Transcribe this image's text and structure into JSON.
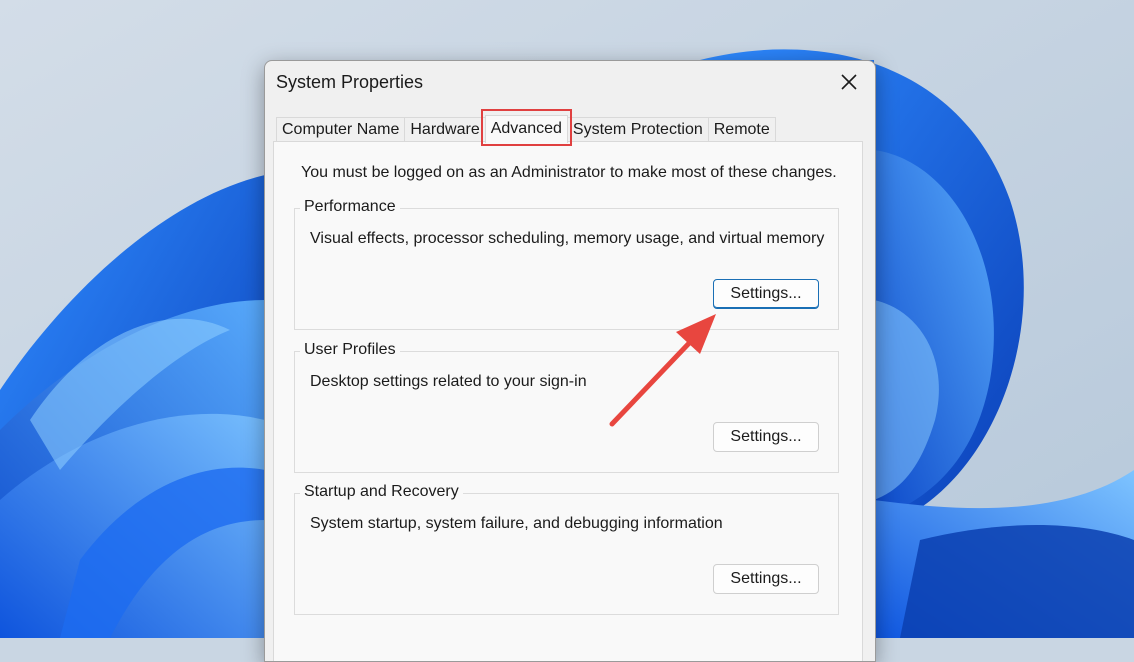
{
  "dialog": {
    "title": "System Properties",
    "close_icon": "close-icon"
  },
  "tabs": [
    {
      "label": "Computer Name",
      "active": false
    },
    {
      "label": "Hardware",
      "active": false
    },
    {
      "label": "Advanced",
      "active": true,
      "highlighted": true
    },
    {
      "label": "System Protection",
      "active": false
    },
    {
      "label": "Remote",
      "active": false
    }
  ],
  "panel": {
    "admin_note": "You must be logged on as an Administrator to make most of these changes.",
    "groups": [
      {
        "label": "Performance",
        "description": "Visual effects, processor scheduling, memory usage, and virtual memory",
        "button_label": "Settings...",
        "focused": true
      },
      {
        "label": "User Profiles",
        "description": "Desktop settings related to your sign-in",
        "button_label": "Settings...",
        "focused": false
      },
      {
        "label": "Startup and Recovery",
        "description": "System startup, system failure, and debugging information",
        "button_label": "Settings...",
        "focused": false
      }
    ]
  },
  "annotation": {
    "highlight_color": "#e04040",
    "arrow_color": "#e8463f"
  },
  "colors": {
    "focus_border": "#1a6fb5",
    "panel_background": "#f9f9f9",
    "dialog_background": "#f0f0f0"
  }
}
